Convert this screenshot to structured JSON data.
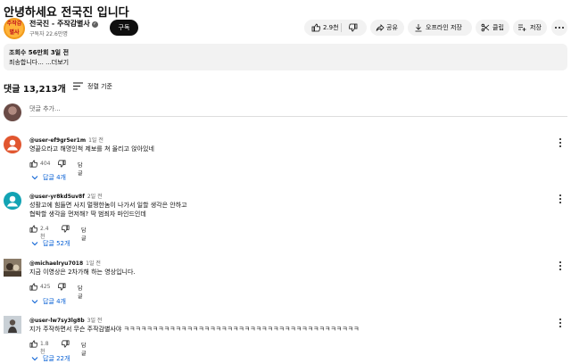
{
  "video": {
    "title": "안녕하세요 전국진 입니다",
    "channel_name": "전국진 - 주작감별사",
    "avatar_text": "주작감별사",
    "subscribers": "구독자 22.6만명",
    "subscribe_label": "구독",
    "like_count": "2.9천",
    "share_label": "공유",
    "offline_label": "오프라인 저장",
    "clip_label": "클립",
    "save_label": "저장",
    "views_line": "조회수 56만회  3일 전",
    "description": "죄송합니다... ...더보기"
  },
  "comments_section": {
    "count_label": "댓글 13,213개",
    "sort_label": "정렬 기준",
    "add_placeholder": "댓글 추가..."
  },
  "comments": [
    {
      "user": "@user-ef9gr5er1m",
      "time": "1일 전",
      "lines": [
        "영끝으라고 해명인척 제보를 쳐 올리고 앉아있네"
      ],
      "likes": "404",
      "reply_label": "답글",
      "replies_label": "답글 4개",
      "avatar_color": "#e1562f"
    },
    {
      "user": "@user-yr8kd5uv8f",
      "time": "2일 전",
      "lines": [
        "성활고에 힘들면 사지 멀쩡한놈이 나가서 일할 생각은 안하고",
        "협박할 생각을 먼저해? 딱 범죄자 마인드인데"
      ],
      "likes": "2.4천",
      "reply_label": "답글",
      "replies_label": "답글 52개",
      "avatar_color": "#12a3b4"
    },
    {
      "user": "@michaelryu7018",
      "time": "1일 전",
      "lines": [
        "지금 이영상은 2차가해 하는 영상입니다."
      ],
      "likes": "425",
      "reply_label": "답글",
      "replies_label": "답글 4개",
      "avatar_color": "#5a4a3c"
    },
    {
      "user": "@user-lw7sy3lg8b",
      "time": "3일 전",
      "lines": [
        "지가 주작하면서 무슨 주작감별사야 ㅋㅋㅋㅋㅋㅋㅋㅋㅋㅋㅋㅋㅋㅋㅋㅋㅋㅋㅋㅋㅋㅋㅋㅋㅋㅋㅋㅋㅋㅋㅋㅋㅋㅋㅋㅋㅋㅋㅋㅋㅋ"
      ],
      "likes": "1.8천",
      "reply_label": "답글",
      "replies_label": "답글 22개",
      "avatar_color": "#b8c0c8"
    }
  ]
}
